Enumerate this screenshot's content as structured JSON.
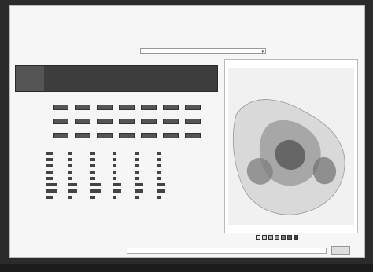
{
  "header": {
    "intro": "",
    "select_prompt": "",
    "select_value": ""
  },
  "left": {
    "step_label": "",
    "tabs": [
      {
        "label": "",
        "selected": true
      },
      {
        "label": "",
        "selected": false
      },
      {
        "label": "",
        "selected": false
      },
      {
        "label": "",
        "selected": false
      },
      {
        "label": "",
        "selected": false
      },
      {
        "label": "",
        "selected": false
      }
    ],
    "segment_title": "",
    "segment_rows": [
      "",
      "",
      ""
    ],
    "segment_note": "",
    "table_title": "",
    "table_rows": [
      "",
      "",
      "",
      "",
      "",
      "",
      "",
      ""
    ],
    "table_values": [
      [
        0.35,
        0.2,
        0.25,
        0.2,
        0.25,
        0.25
      ],
      [
        0.35,
        0.2,
        0.25,
        0.2,
        0.25,
        0.25
      ],
      [
        0.35,
        0.2,
        0.25,
        0.2,
        0.25,
        0.25
      ],
      [
        0.35,
        0.2,
        0.25,
        0.2,
        0.25,
        0.25
      ],
      [
        0.35,
        0.2,
        0.25,
        0.2,
        0.25,
        0.25
      ],
      [
        0.6,
        0.45,
        0.55,
        0.45,
        0.45,
        0.45
      ],
      [
        0.6,
        0.45,
        0.55,
        0.45,
        0.45,
        0.45
      ],
      [
        0.35,
        0.2,
        0.25,
        0.2,
        0.25,
        0.25
      ]
    ]
  },
  "map": {
    "title": "",
    "legend_low": "",
    "legend_high": ""
  },
  "footer": {
    "note": ""
  },
  "status": {
    "text": ""
  },
  "colors": {
    "shade_1": "#e6e6e6",
    "shade_2": "#cfcfcf",
    "shade_3": "#b3b3b3",
    "shade_4": "#969696",
    "shade_5": "#7a7a7a",
    "shade_6": "#5c5c5c",
    "shade_7": "#3f3f3f"
  }
}
